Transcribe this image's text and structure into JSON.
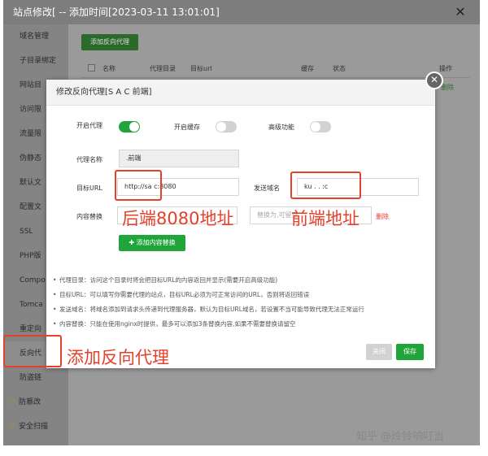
{
  "outer_window": {
    "title": "站点修改[        -- 添加时间[2023-03-11 13:01:01]",
    "close_glyph": "✕"
  },
  "sidebar": {
    "items": [
      {
        "label": "域名管理",
        "icon": ""
      },
      {
        "label": "子目录绑定",
        "icon": ""
      },
      {
        "label": "网站目",
        "icon": ""
      },
      {
        "label": "访问限",
        "icon": ""
      },
      {
        "label": "流量限",
        "icon": ""
      },
      {
        "label": "伪静态",
        "icon": ""
      },
      {
        "label": "默认文",
        "icon": ""
      },
      {
        "label": "配置文",
        "icon": ""
      },
      {
        "label": "SSL",
        "icon": ""
      },
      {
        "label": "PHP版",
        "icon": ""
      },
      {
        "label": "Compo",
        "icon": ""
      },
      {
        "label": "Tomca",
        "icon": ""
      },
      {
        "label": "重定向",
        "icon": ""
      },
      {
        "label": "反向代",
        "icon": ""
      },
      {
        "label": "防盗链",
        "icon": ""
      },
      {
        "label": "防篡改",
        "icon": "shield-icon"
      },
      {
        "label": "安全扫描",
        "icon": "shield-icon"
      }
    ]
  },
  "outer_main": {
    "add_proxy_label": "添加反向代理",
    "columns": [
      "名称",
      "代理目录",
      "目标url",
      "缓存",
      "状态",
      "操作"
    ],
    "op_link": "删除"
  },
  "dialog": {
    "title": "修改反向代理[S  A C 前端]",
    "close_glyph": "✕",
    "enable_proxy_label": "开启代理",
    "enable_proxy_on": true,
    "enable_cache_label": "开启缓存",
    "enable_cache_on": false,
    "advanced_label": "高级功能",
    "advanced_on": false,
    "proxy_name_label": "代理名称",
    "proxy_name_value": "   .前端",
    "target_url_label": "目标URL",
    "target_url_value": "http://sa         c:8080",
    "send_domain_label": "发送域名",
    "send_domain_value": "ku    .  .  :c",
    "content_replace_label": "内容替换",
    "replace_placeholder": "替换为,可留空",
    "delete_label": "删除",
    "add_replace_label": "添加内容替换",
    "tips": [
      "代理目录：访问这个目录时将会把目标URL的内容返回并显示(需要开启高级功能)",
      "目标URL：可以填写你需要代理的站点，目标URL必须为可正常访问的URL，否则将返回错误",
      "发送域名：将域名添加到请求头传递到代理服务器，默认为目标URL域名，若设置不当可能导致代理无法正常运行",
      "内容替换：只能在使用nginx时提供，最多可以添加3条替换内容,如果不需要替换请留空"
    ],
    "close_button": "关闭",
    "save_button": "保存"
  },
  "annotations": {
    "backend_note": "后端8080地址",
    "frontend_note": "前端地址",
    "add_proxy_note": "添加反向代理"
  },
  "watermark": "知乎 @玲铃响叮当",
  "colors": {
    "accent_green": "#20a53a",
    "annotation_red": "#e5402a",
    "delete_red": "#e23a2e"
  }
}
